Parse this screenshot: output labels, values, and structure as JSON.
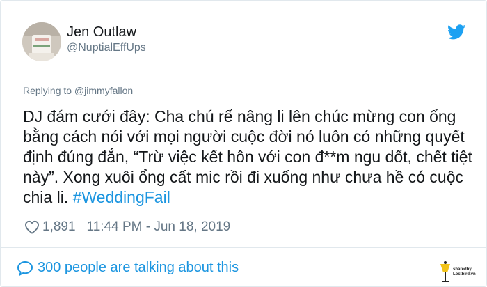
{
  "tweet": {
    "author_name": "Jen Outlaw",
    "author_handle": "@NuptialEffUps",
    "replying_to": "Replying to @jimmyfallon",
    "text": "DJ đám cưới đây: Cha chú rể nâng li lên chúc mừng con ổng bằng cách nói với mọi người cuộc đời nó luôn có những quyết định đúng đắn, “Trừ việc kết hôn với con đ**m ngu dốt, chết tiệt này”. Xong xuôi ổng cất mic rồi đi xuống như chưa hề có cuộc chia li.",
    "hashtag": "#WeddingFail",
    "likes": "1,891",
    "timestamp": "11:44 PM - Jun 18, 2019",
    "talking_about": "300 people are talking about this"
  },
  "watermark": {
    "line1": "sharedby",
    "line2": "Lostbird.vn"
  },
  "colors": {
    "accent": "#1b95e0",
    "secondary_text": "#657786",
    "primary_text": "#14171a",
    "border": "#e1e8ed"
  },
  "icons": {
    "brand": "twitter-bird-icon",
    "like": "heart-icon",
    "reply": "speech-bubble-icon",
    "watermark": "bird-lamp-logo-icon"
  }
}
